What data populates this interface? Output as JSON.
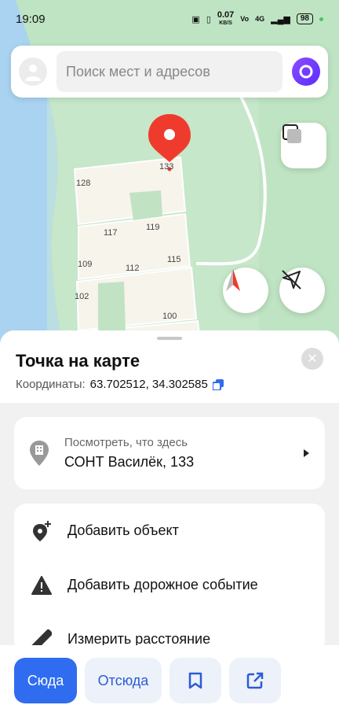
{
  "status_bar": {
    "time": "19:09",
    "speed": "0.07",
    "speed_unit": "KB/S",
    "network": "4G",
    "battery": "98"
  },
  "search": {
    "placeholder": "Поиск мест и адресов"
  },
  "map": {
    "pin_label": "133",
    "plots": [
      "128",
      "117",
      "119",
      "109",
      "112",
      "115",
      "102",
      "100"
    ]
  },
  "sheet": {
    "title": "Точка на карте",
    "coords_label": "Координаты:",
    "coords_value": "63.702512, 34.302585"
  },
  "whatshere": {
    "label": "Посмотреть, что здесь",
    "value": "СОНТ Василёк, 133"
  },
  "actions": [
    {
      "label": "Добавить объект",
      "icon": "add-place-icon"
    },
    {
      "label": "Добавить дорожное событие",
      "icon": "warning-icon"
    },
    {
      "label": "Измерить расстояние",
      "icon": "ruler-icon"
    }
  ],
  "toolbar": {
    "to_label": "Сюда",
    "from_label": "Отсюда",
    "bookmark_icon": "bookmark-icon",
    "share_icon": "share-icon"
  },
  "colors": {
    "accent": "#2f6cf0",
    "pin": "#ef3b2d",
    "water": "#a9d3f0",
    "park": "#bfe4c3"
  }
}
